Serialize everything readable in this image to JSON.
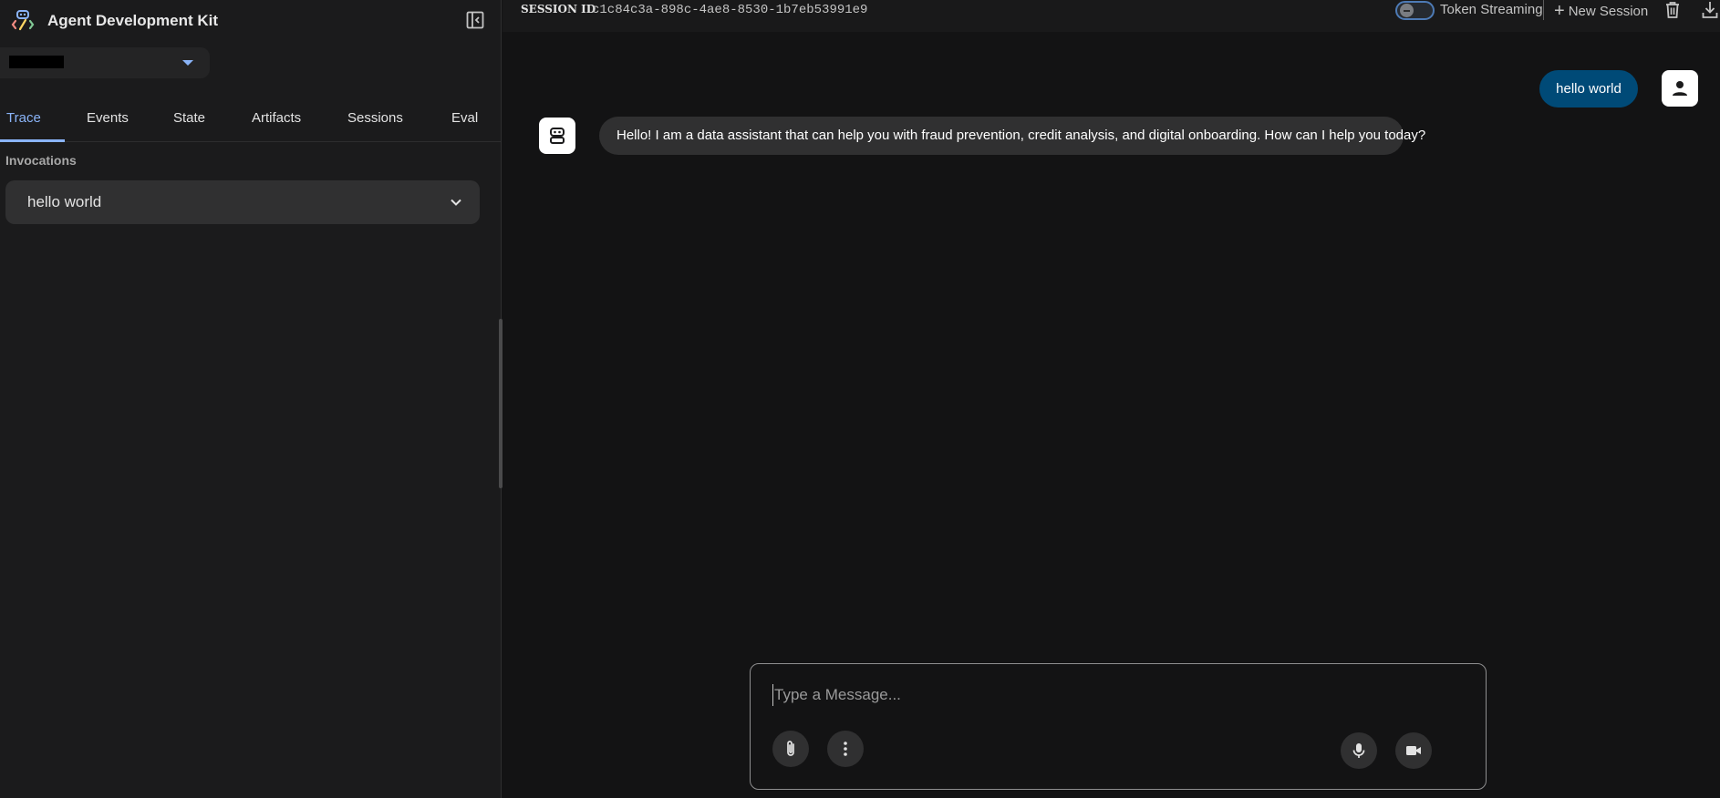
{
  "brand": {
    "title": "Agent Development Kit"
  },
  "app_selector": {
    "value": ""
  },
  "tabs": [
    {
      "label": "Trace",
      "active": true
    },
    {
      "label": "Events",
      "active": false
    },
    {
      "label": "State",
      "active": false
    },
    {
      "label": "Artifacts",
      "active": false
    },
    {
      "label": "Sessions",
      "active": false
    },
    {
      "label": "Eval",
      "active": false
    }
  ],
  "sidebar": {
    "section_label": "Invocations",
    "invocations": [
      {
        "label": "hello world"
      }
    ]
  },
  "topbar": {
    "session_label": "SESSION ID",
    "session_id": "c1c84c3a-898c-4ae8-8530-1b7eb53991e9",
    "token_streaming_label": "Token Streaming",
    "token_streaming_on": false,
    "new_session_label": "New Session"
  },
  "chat": {
    "messages": [
      {
        "role": "user",
        "text": "hello world"
      },
      {
        "role": "bot",
        "text": "Hello! I am a data assistant that can help you with fraud prevention, credit analysis, and digital onboarding. How can I help you today?"
      }
    ]
  },
  "composer": {
    "placeholder": "Type a Message...",
    "value": ""
  },
  "icons": {
    "brand": "adk-logo-icon",
    "collapse": "sidebar-collapse-icon",
    "chevron": "chevron-down-icon",
    "delete": "trash-icon",
    "download": "download-icon",
    "user": "person-icon",
    "bot": "robot-icon",
    "attach": "paperclip-icon",
    "more": "more-vert-icon",
    "mic": "microphone-icon",
    "video": "videocam-icon"
  },
  "colors": {
    "accent": "#8ab4f8",
    "user_bubble": "#004a77",
    "bot_bubble": "#303031",
    "background": "#131314",
    "sidebar": "#1b1b1c"
  }
}
